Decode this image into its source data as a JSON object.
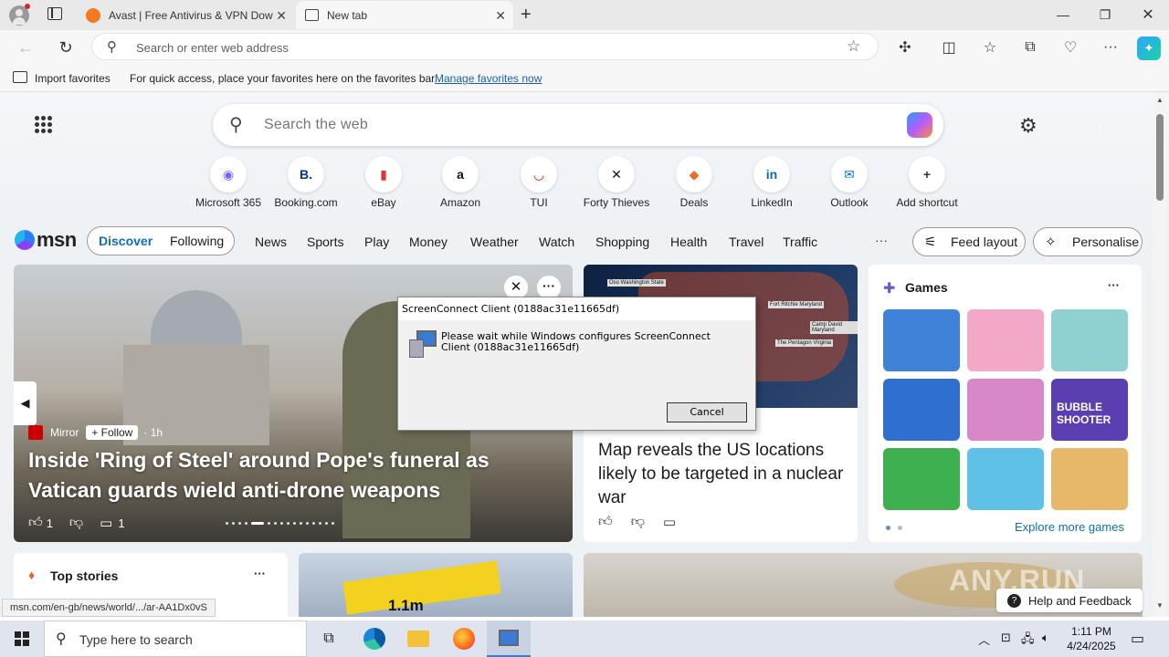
{
  "browser": {
    "tabs": [
      {
        "label": "Avast | Free Antivirus & VPN Dow",
        "active": false
      },
      {
        "label": "New tab",
        "active": true
      }
    ],
    "address_placeholder": "Search or enter web address",
    "favorites": {
      "import_label": "Import favorites",
      "hint": "For quick access, place your favorites here on the favorites bar.",
      "manage_link": "Manage favorites now"
    }
  },
  "newtab": {
    "search_placeholder": "Search the web",
    "signin": "Sign in",
    "shortcuts": [
      {
        "label": "Microsoft 365",
        "glyph": "◉",
        "color": "#7b61ff"
      },
      {
        "label": "Booking.com",
        "glyph": "B.",
        "color": "#003580"
      },
      {
        "label": "eBay",
        "glyph": "▮",
        "color": "#e53238"
      },
      {
        "label": "Amazon",
        "glyph": "a",
        "color": "#111111"
      },
      {
        "label": "TUI",
        "glyph": "◡",
        "color": "#d40e14"
      },
      {
        "label": "Forty Thieves",
        "glyph": "✕",
        "color": "#111111"
      },
      {
        "label": "Deals",
        "glyph": "◆",
        "color": "#e86a25"
      },
      {
        "label": "LinkedIn",
        "glyph": "in",
        "color": "#0a66c2"
      },
      {
        "label": "Outlook",
        "glyph": "✉",
        "color": "#0078d4"
      },
      {
        "label": "Add shortcut",
        "glyph": "+",
        "color": "#333333"
      }
    ]
  },
  "msn": {
    "logo": "msn",
    "toggle": [
      "Discover",
      "Following"
    ],
    "nav": [
      "News",
      "Sports",
      "Play",
      "Money",
      "Weather",
      "Watch",
      "Shopping",
      "Health",
      "Travel",
      "Traffic"
    ],
    "more": "···",
    "feed_layout": "Feed layout",
    "personalise": "Personalise"
  },
  "hero": {
    "source": "Mirror",
    "follow": "Follow",
    "age": "· 1h",
    "headline": "Inside 'Ring of Steel' around Pope's funeral as Vatican guards wield anti-drone weapons",
    "likes": "1",
    "comments": "1"
  },
  "map_story": {
    "headline": "Map reveals the US locations likely to be targeted in a nuclear war",
    "labels": [
      "Oso Washington State",
      "Fort Ritchie Maryland",
      "Camp David Maryland",
      "The Pentagon Virginia"
    ]
  },
  "games": {
    "title": "Games",
    "explore": "Explore more games",
    "bubble_text": "BUBBLE SHOOTER",
    "tiles": [
      "#3f83d8",
      "#f4a8c8",
      "#8fd0d0",
      "#2f6fd0",
      "#d887c8",
      "#5a3fb0",
      "#3fb04f",
      "#5fc0e8",
      "#e8b86a"
    ]
  },
  "top_stories": {
    "title": "Top stories"
  },
  "teaser_text": "1.1m",
  "dialog": {
    "title": "ScreenConnect Client (0188ac31e11665df)",
    "message": "Please wait while Windows configures ScreenConnect Client (0188ac31e11665df)",
    "cancel": "Cancel"
  },
  "status_url": "msn.com/en-gb/news/world/.../ar-AA1Dx0vS",
  "help_feedback": "Help and Feedback",
  "watermark": "ANY.RUN",
  "taskbar": {
    "search_placeholder": "Type here to search",
    "time": "1:11 PM",
    "date": "4/24/2025"
  }
}
